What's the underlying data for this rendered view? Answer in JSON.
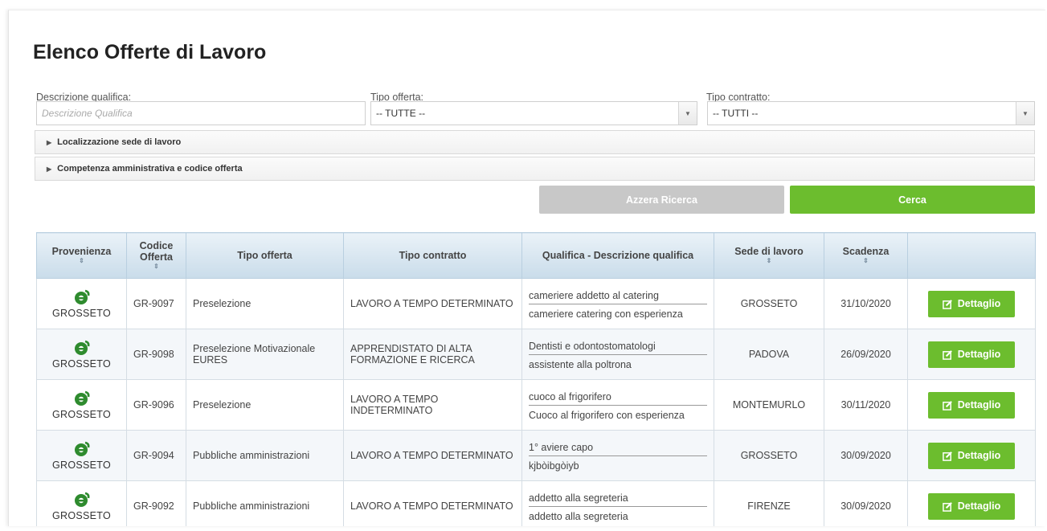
{
  "page": {
    "title": "Elenco Offerte di Lavoro"
  },
  "filters": {
    "descrizione_label": "Descrizione qualifica:",
    "descrizione_placeholder": "Descrizione Qualifica",
    "tipo_offerta_label": "Tipo offerta:",
    "tipo_offerta_value": "-- TUTTE --",
    "tipo_contratto_label": "Tipo contratto:",
    "tipo_contratto_value": "-- TUTTI --"
  },
  "accordions": [
    {
      "label": "Localizzazione sede di lavoro"
    },
    {
      "label": "Competenza amministrativa e codice offerta"
    }
  ],
  "actions": {
    "reset_label": "Azzera Ricerca",
    "search_label": "Cerca"
  },
  "table": {
    "headers": {
      "provenienza": "Provenienza",
      "codice": "Codice Offerta",
      "tipo_offerta": "Tipo offerta",
      "tipo_contratto": "Tipo contratto",
      "qualifica": "Qualifica - Descrizione qualifica",
      "sede": "Sede di lavoro",
      "scadenza": "Scadenza",
      "sort_glyph": "⇕"
    },
    "rows": [
      {
        "provenienza": "GROSSETO",
        "codice": "GR-9097",
        "tipo_offerta": "Preselezione",
        "tipo_contratto": "LAVORO A TEMPO DETERMINATO",
        "qualifica": "cameriere addetto al catering",
        "descrizione": "cameriere catering con esperienza",
        "sede": "GROSSETO",
        "scadenza": "31/10/2020",
        "azione": "Dettaglio"
      },
      {
        "provenienza": "GROSSETO",
        "codice": "GR-9098",
        "tipo_offerta": "Preselezione Motivazionale EURES",
        "tipo_contratto": "APPRENDISTATO DI ALTA FORMAZIONE E RICERCA",
        "qualifica": "Dentisti e odontostomatologi",
        "descrizione": "assistente alla poltrona",
        "sede": "PADOVA",
        "scadenza": "26/09/2020",
        "azione": "Dettaglio"
      },
      {
        "provenienza": "GROSSETO",
        "codice": "GR-9096",
        "tipo_offerta": "Preselezione",
        "tipo_contratto": "LAVORO A TEMPO INDETERMINATO",
        "qualifica": "cuoco al frigorifero",
        "descrizione": "Cuoco al frigorifero con esperienza",
        "sede": "MONTEMURLO",
        "scadenza": "30/11/2020",
        "azione": "Dettaglio"
      },
      {
        "provenienza": "GROSSETO",
        "codice": "GR-9094",
        "tipo_offerta": "Pubbliche amministrazioni",
        "tipo_contratto": "LAVORO A TEMPO DETERMINATO",
        "qualifica": "1° aviere capo",
        "descrizione": "kjbòibgòiyb",
        "sede": "GROSSETO",
        "scadenza": "30/09/2020",
        "azione": "Dettaglio"
      },
      {
        "provenienza": "GROSSETO",
        "codice": "GR-9092",
        "tipo_offerta": "Pubbliche amministrazioni",
        "tipo_contratto": "LAVORO A TEMPO DETERMINATO",
        "qualifica": "addetto alla segreteria",
        "descrizione": "addetto alla segreteria",
        "sede": "FIRENZE",
        "scadenza": "30/09/2020",
        "azione": "Dettaglio"
      }
    ]
  },
  "colors": {
    "accent_green": "#6cbd2e",
    "header_blue": "#c9dcea",
    "logo_green": "#2e8b2e"
  },
  "icons": {
    "logo": "provincia-logo-icon",
    "detail": "edit-icon"
  }
}
